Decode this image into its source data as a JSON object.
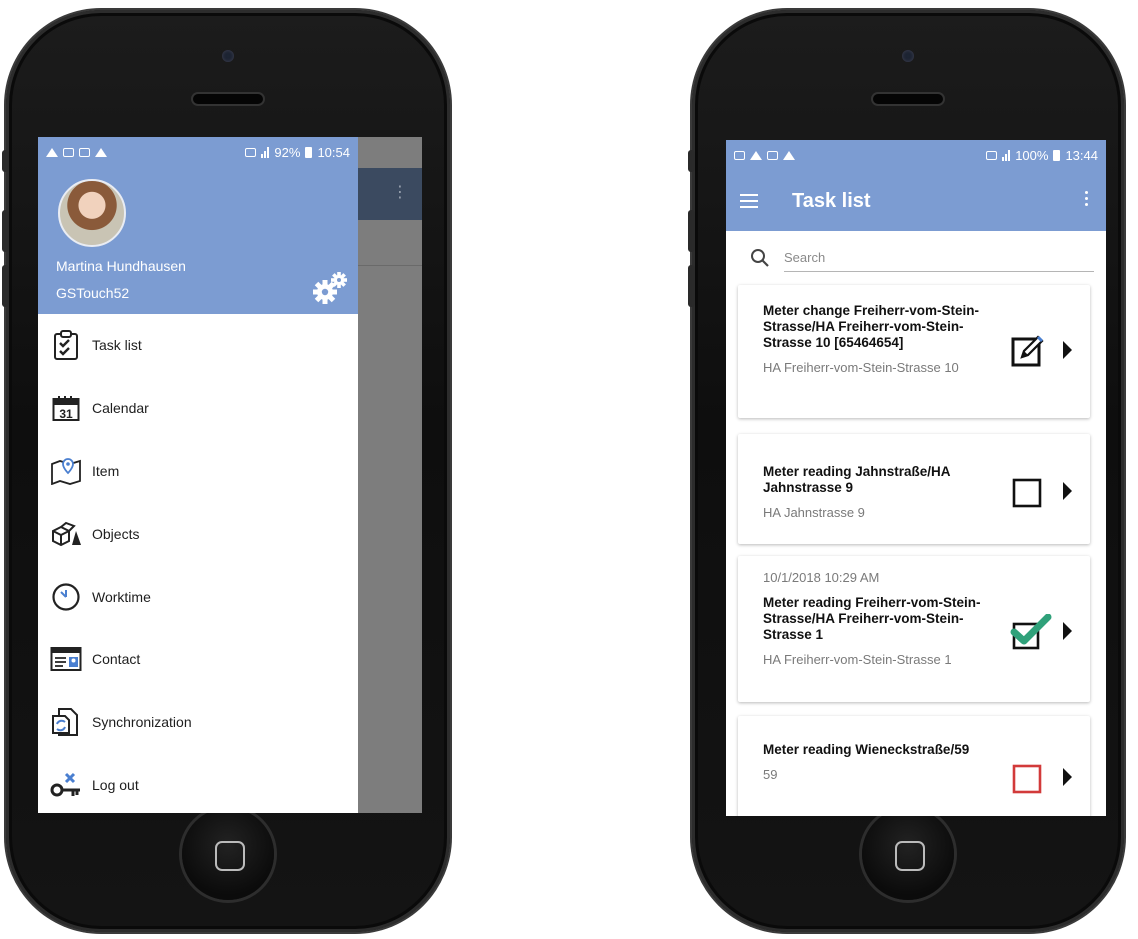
{
  "left_phone": {
    "status_bar": {
      "battery": "92%",
      "time": "10:54"
    },
    "drawer": {
      "user_name": "Martina Hundhausen",
      "user_account": "GSTouch52",
      "menu": [
        {
          "id": "task-list",
          "label": "Task list",
          "icon": "clipboard-check-icon"
        },
        {
          "id": "calendar",
          "label": "Calendar",
          "icon": "calendar-icon",
          "icon_text": "31"
        },
        {
          "id": "item",
          "label": "Item",
          "icon": "map-pin-icon"
        },
        {
          "id": "objects",
          "label": "Objects",
          "icon": "boxes-icon"
        },
        {
          "id": "worktime",
          "label": "Worktime",
          "icon": "clock-icon"
        },
        {
          "id": "contact",
          "label": "Contact",
          "icon": "contact-card-icon"
        },
        {
          "id": "synchronization",
          "label": "Synchronization",
          "icon": "sync-icon"
        },
        {
          "id": "log-out",
          "label": "Log out",
          "icon": "key-logout-icon"
        }
      ]
    }
  },
  "right_phone": {
    "status_bar": {
      "battery": "100%",
      "time": "13:44"
    },
    "app_bar": {
      "title": "Task list",
      "menu_icon": "hamburger-icon",
      "overflow_icon": "kebab-icon"
    },
    "search": {
      "placeholder": "Search",
      "value": ""
    },
    "tasks": [
      {
        "date": "",
        "title": "Meter change Freiherr-vom-Stein-Strasse/HA Freiherr-vom-Stein-Strasse 10 [65464654]",
        "subtitle": "HA Freiherr-vom-Stein-Strasse 10",
        "status": "in-progress",
        "status_icon": "pencil-edit-icon"
      },
      {
        "date": "",
        "title": "Meter reading Jahnstraße/HA Jahnstrasse 9",
        "subtitle": "HA Jahnstrasse 9",
        "status": "open",
        "status_icon": "empty-checkbox-icon"
      },
      {
        "date": "10/1/2018 10:29 AM",
        "title": "Meter reading Freiherr-vom-Stein-Strasse/HA Freiherr-vom-Stein-Strasse 1",
        "subtitle": "HA Freiherr-vom-Stein-Strasse 1",
        "status": "done",
        "status_icon": "checked-checkbox-icon"
      },
      {
        "date": "",
        "title": "Meter reading Wieneckstraße/59",
        "subtitle": "59",
        "status": "overdue",
        "status_icon": "red-checkbox-icon"
      }
    ]
  },
  "colors": {
    "accent": "#7c9cd2",
    "drawer_overlay": "#7d7d7d",
    "check_green": "#2fa17a",
    "alert_red": "#d23a3a"
  }
}
